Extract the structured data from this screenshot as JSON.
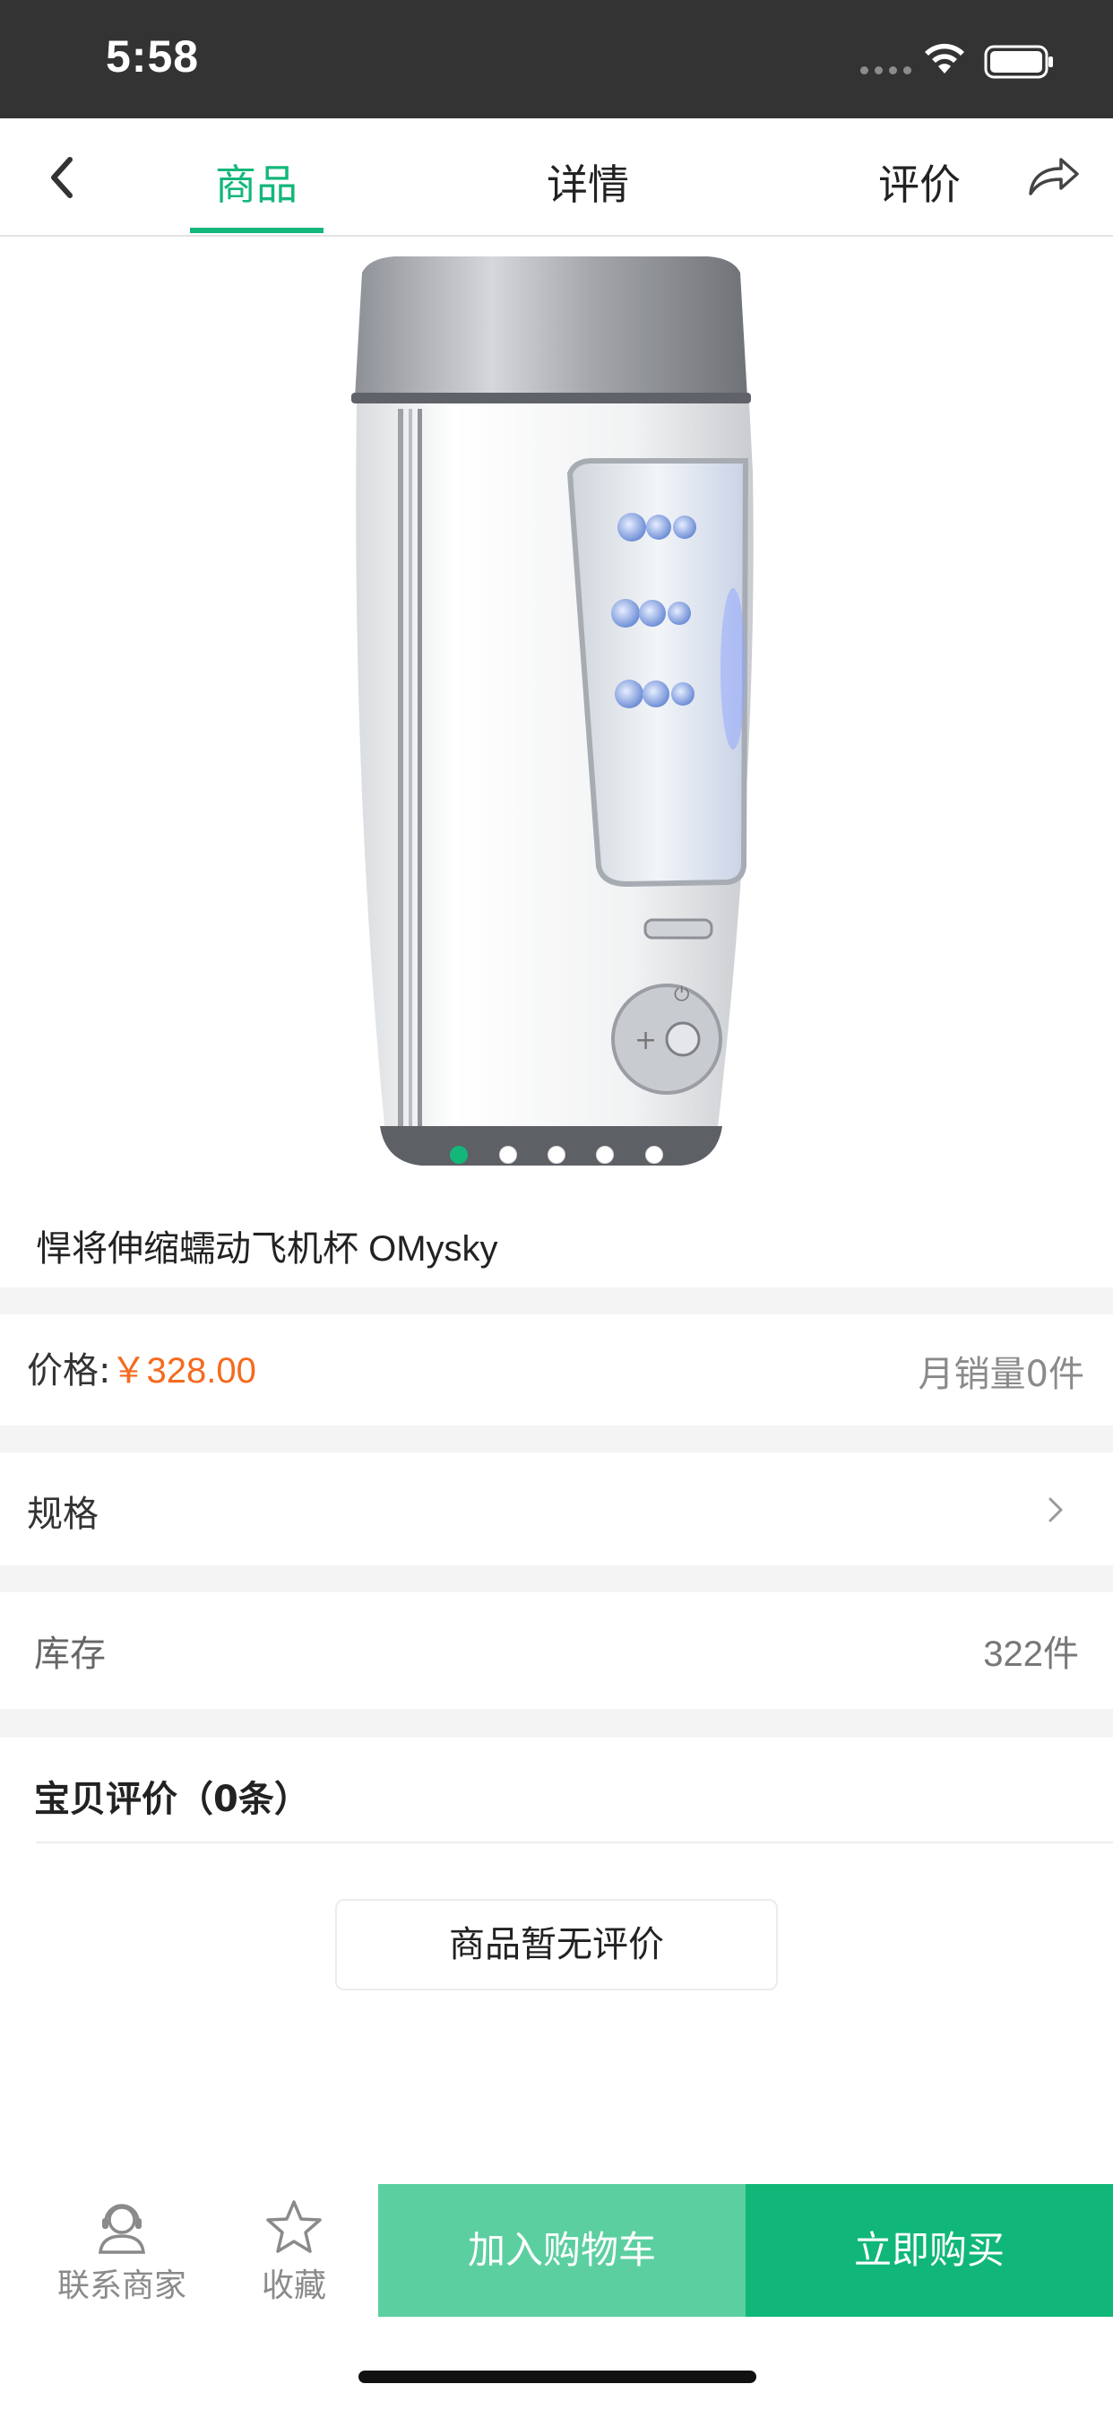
{
  "status_bar": {
    "time": "5:58"
  },
  "nav": {
    "tabs": [
      {
        "label": "商品",
        "active": true
      },
      {
        "label": "详情",
        "active": false
      },
      {
        "label": "评价",
        "active": false
      }
    ],
    "accent_color": "#13b77a"
  },
  "carousel": {
    "total_images": 5,
    "active_index": 0
  },
  "product": {
    "title": "悍将伸缩蠕动飞机杯 OMysky",
    "price_label": "价格:",
    "price_value": "￥328.00",
    "monthly_sales": "月销量0件",
    "spec_label": "规格",
    "stock_label": "库存",
    "stock_value": "322件"
  },
  "reviews": {
    "header": "宝贝评价（0条）",
    "empty_text": "商品暂无评价"
  },
  "bottom_bar": {
    "contact_label": "联系商家",
    "favorite_label": "收藏",
    "add_to_cart_label": "加入购物车",
    "buy_now_label": "立即购买",
    "add_to_cart_color": "#5ccfa0",
    "buy_now_color": "#10b778"
  },
  "colors": {
    "price": "#f56a1e",
    "status_bar": "#333333"
  }
}
